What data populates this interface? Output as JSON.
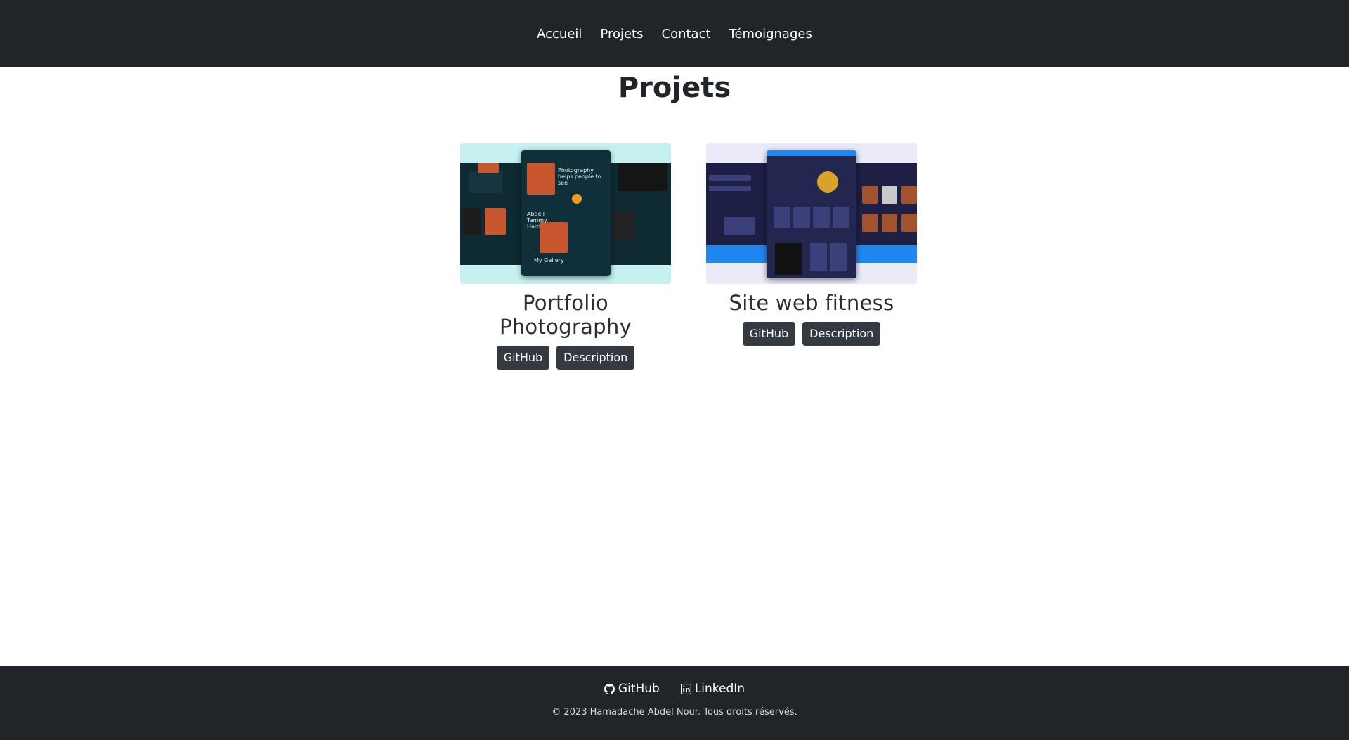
{
  "nav": {
    "items": [
      "Accueil",
      "Projets",
      "Contact",
      "Témoignages"
    ]
  },
  "page": {
    "title": "Projets"
  },
  "projects": [
    {
      "title_line1": "Portfolio",
      "title_line2": "Photography",
      "github_label": "GitHub",
      "description_label": "Description",
      "thumbnail_text": {
        "headline": "Photography helps people to see",
        "gallery": "My Gallery",
        "name": "Abdell Tammy Hard"
      }
    },
    {
      "title": "Site web fitness",
      "github_label": "GitHub",
      "description_label": "Description"
    }
  ],
  "footer": {
    "github_label": "GitHub",
    "linkedin_label": "LinkedIn",
    "copyright": "© 2023 Hamadache Abdel Nour. Tous droits réservés."
  },
  "colors": {
    "nav_bg": "#212529",
    "button_bg": "#343a40",
    "footer_bg": "#212529"
  }
}
